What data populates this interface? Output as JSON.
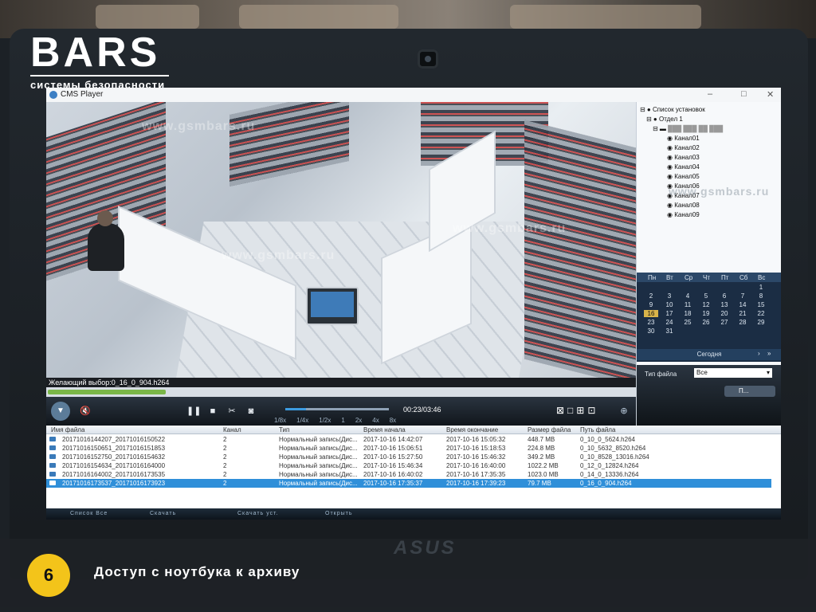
{
  "brand": {
    "name": "BARS",
    "tagline": "системы безопасности"
  },
  "watermark": "www.gsmbars.ru",
  "app": {
    "title": "CMS Player"
  },
  "video": {
    "selected_label": "Желающий выбор:0_16_0_904.h264",
    "time": "00:23/03:46",
    "speeds": [
      "1/8x",
      "1/4x",
      "1/2x",
      "1",
      "2x",
      "4x",
      "8x"
    ],
    "progress_fraction": 0.2
  },
  "tree": {
    "root": "Список установок",
    "group": "Отдел 1",
    "channels": [
      "Канал01",
      "Канал02",
      "Канал03",
      "Канал04",
      "Канал05",
      "Канал06",
      "Канал07",
      "Канал08",
      "Канал09"
    ]
  },
  "calendar": {
    "weekdays": [
      "Пн",
      "Вт",
      "Ср",
      "Чт",
      "Пт",
      "Сб",
      "Вс"
    ],
    "weeks": [
      [
        "",
        "",
        "",
        "",
        "",
        "",
        "1"
      ],
      [
        "2",
        "3",
        "4",
        "5",
        "6",
        "7",
        "8"
      ],
      [
        "9",
        "10",
        "11",
        "12",
        "13",
        "14",
        "15"
      ],
      [
        "16",
        "17",
        "18",
        "19",
        "20",
        "21",
        "22"
      ],
      [
        "23",
        "24",
        "25",
        "26",
        "27",
        "28",
        "29"
      ],
      [
        "30",
        "31",
        "",
        "",
        "",
        "",
        ""
      ]
    ],
    "highlighted": "16",
    "today_label": "Сегодня"
  },
  "filter": {
    "type_label": "Тип файла",
    "type_value": "Все",
    "search_label": "П..."
  },
  "table": {
    "columns": [
      "Имя файла",
      "Канал",
      "Тип",
      "Время начала",
      "Время окончание",
      "Размер файла",
      "Путь файла"
    ],
    "rows": [
      [
        "20171016144207_20171016150522",
        "2",
        "Нормальный запись(Дис...",
        "2017-10-16 14:42:07",
        "2017-10-16 15:05:32",
        "448.7 MB",
        "0_10_0_5624.h264"
      ],
      [
        "20171016150651_20171016151853",
        "2",
        "Нормальный запись(Дис...",
        "2017-10-16 15:06:51",
        "2017-10-16 15:18:53",
        "224.8 MB",
        "0_10_5632_8520.h264"
      ],
      [
        "20171016152750_20171016154632",
        "2",
        "Нормальный запись(Дис...",
        "2017-10-16 15:27:50",
        "2017-10-16 15:46:32",
        "349.2 MB",
        "0_10_8528_13016.h264"
      ],
      [
        "20171016154634_20171016164000",
        "2",
        "Нормальный запись(Дис...",
        "2017-10-16 15:46:34",
        "2017-10-16 16:40:00",
        "1022.2 MB",
        "0_12_0_12824.h264"
      ],
      [
        "20171016164002_20171016173535",
        "2",
        "Нормальный запись(Дис...",
        "2017-10-16 16:40:02",
        "2017-10-16 17:35:35",
        "1023.0 MB",
        "0_14_0_13336.h264"
      ],
      [
        "20171016173537_20171016173923",
        "2",
        "Нормальный запись(Дис...",
        "2017-10-16 17:35:37",
        "2017-10-16 17:39:23",
        "79.7 MB",
        "0_16_0_904.h264"
      ]
    ],
    "selected_index": 5
  },
  "taskbar": [
    "Список Все",
    "Скачать",
    "Скачать уст.",
    "Открыть"
  ],
  "laptop_brand": "ASUS",
  "slide": {
    "number": "6",
    "caption": "Доступ с ноутбука к архиву"
  }
}
